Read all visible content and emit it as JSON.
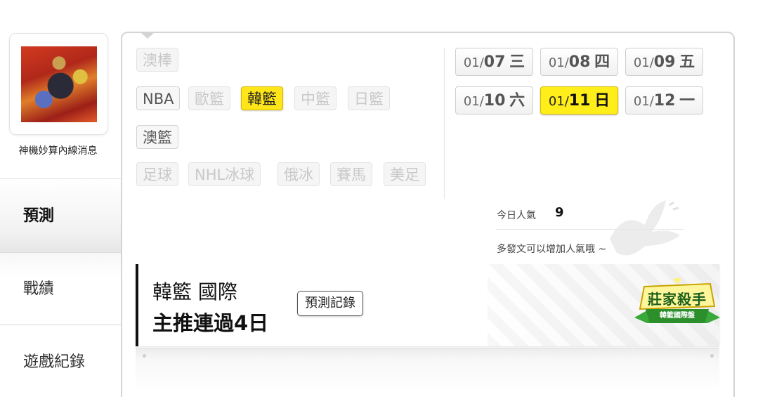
{
  "profile": {
    "name": "神機妙算內線消息"
  },
  "nav": {
    "tabs": [
      {
        "label": "預測",
        "active": true
      },
      {
        "label": "戰績",
        "active": false
      },
      {
        "label": "遊戲紀錄",
        "active": false
      }
    ]
  },
  "leagues": {
    "row1": [
      {
        "label": "澳棒",
        "state": "dim"
      }
    ],
    "row2": [
      {
        "label": "NBA",
        "state": "normal"
      },
      {
        "label": "歐籃",
        "state": "dim"
      },
      {
        "label": "韓籃",
        "state": "active"
      },
      {
        "label": "中籃",
        "state": "dim"
      },
      {
        "label": "日籃",
        "state": "dim"
      }
    ],
    "row3": [
      {
        "label": "澳籃",
        "state": "normal"
      }
    ],
    "row4": [
      {
        "label": "足球",
        "state": "dim"
      },
      {
        "label": "NHL冰球",
        "state": "dim"
      },
      {
        "label": "俄冰",
        "state": "dim"
      },
      {
        "label": "賽馬",
        "state": "dim"
      },
      {
        "label": "美足",
        "state": "dim"
      }
    ]
  },
  "dates": [
    {
      "month": "01/",
      "day": "07",
      "weekday": "三",
      "active": false
    },
    {
      "month": "01/",
      "day": "08",
      "weekday": "四",
      "active": false
    },
    {
      "month": "01/",
      "day": "09",
      "weekday": "五",
      "active": false
    },
    {
      "month": "01/",
      "day": "10",
      "weekday": "六",
      "active": false
    },
    {
      "month": "01/",
      "day": "11",
      "weekday": "日",
      "active": true
    },
    {
      "month": "01/",
      "day": "12",
      "weekday": "一",
      "active": false
    }
  ],
  "popularity": {
    "label": "今日人氣",
    "count": "9",
    "hint": "多發文可以增加人氣哦 ~"
  },
  "headline": {
    "title": "韓籃 國際",
    "subtitle": "主推連過4日",
    "record_button": "預測記錄",
    "badge_main": "莊家殺手",
    "badge_sub": "韓籃國際盤"
  },
  "colors": {
    "active_yellow": "#ffe619",
    "badge_green": "#3aa83a"
  }
}
